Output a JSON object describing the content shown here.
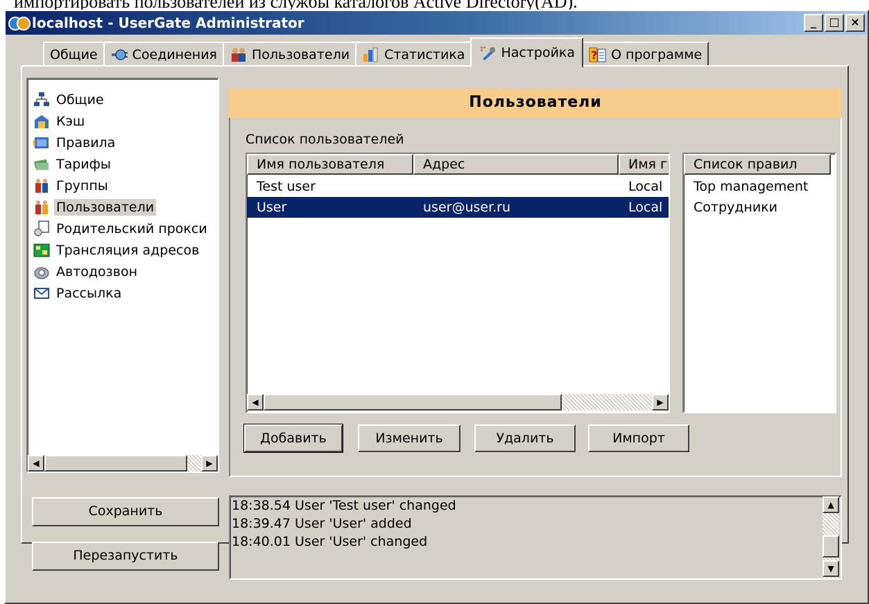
{
  "document_text": "импортировать пользователей из службы каталогов Active Directory(AD).",
  "window": {
    "title": "localhost - UserGate Administrator",
    "minimize": "_",
    "maximize": "□",
    "close": "×"
  },
  "tabs": [
    {
      "label": "Общие",
      "icon": "none"
    },
    {
      "label": "Соединения",
      "icon": "plug-icon"
    },
    {
      "label": "Пользователи",
      "icon": "users-icon"
    },
    {
      "label": "Статистика",
      "icon": "chart-icon"
    },
    {
      "label": "Настройка",
      "icon": "tools-icon",
      "active": true
    },
    {
      "label": "О программе",
      "icon": "help-icon"
    }
  ],
  "nav": {
    "items": [
      {
        "label": "Общие",
        "icon": "network-icon"
      },
      {
        "label": "Кэш",
        "icon": "cache-icon"
      },
      {
        "label": "Правила",
        "icon": "rules-icon"
      },
      {
        "label": "Тарифы",
        "icon": "money-icon"
      },
      {
        "label": "Группы",
        "icon": "group-icon"
      },
      {
        "label": "Пользователи",
        "icon": "users-icon",
        "selected": true
      },
      {
        "label": "Родительский прокси",
        "icon": "proxy-icon"
      },
      {
        "label": "Трансляция адресов",
        "icon": "nat-icon"
      },
      {
        "label": "Автодозвон",
        "icon": "phone-icon"
      },
      {
        "label": "Рассылка",
        "icon": "mail-icon"
      }
    ]
  },
  "section": {
    "title": "Пользователи",
    "list_label": "Список пользователей",
    "columns": [
      "Имя пользователя",
      "Адрес",
      "Имя группы"
    ],
    "rows": [
      {
        "name": "Test user",
        "address": "",
        "group": "Local"
      },
      {
        "name": "User",
        "address": "user@user.ru",
        "group": "Local",
        "selected": true
      }
    ],
    "rules_header": "Список правил",
    "rules": [
      "Top management",
      "Сотрудники"
    ],
    "buttons": {
      "add": "Добавить",
      "edit": "Изменить",
      "delete": "Удалить",
      "import": "Импорт"
    }
  },
  "actions": {
    "save": "Сохранить",
    "restart": "Перезапустить"
  },
  "log": [
    "18:38.54 User 'Test user' changed",
    "18:39.47 User 'User' added",
    "18:40.01 User 'User' changed"
  ],
  "colors": {
    "titlebar_start": "#0a246a",
    "section_header": "#f8cc8a",
    "selection": "#0a246a",
    "face": "#d4d0c8"
  }
}
